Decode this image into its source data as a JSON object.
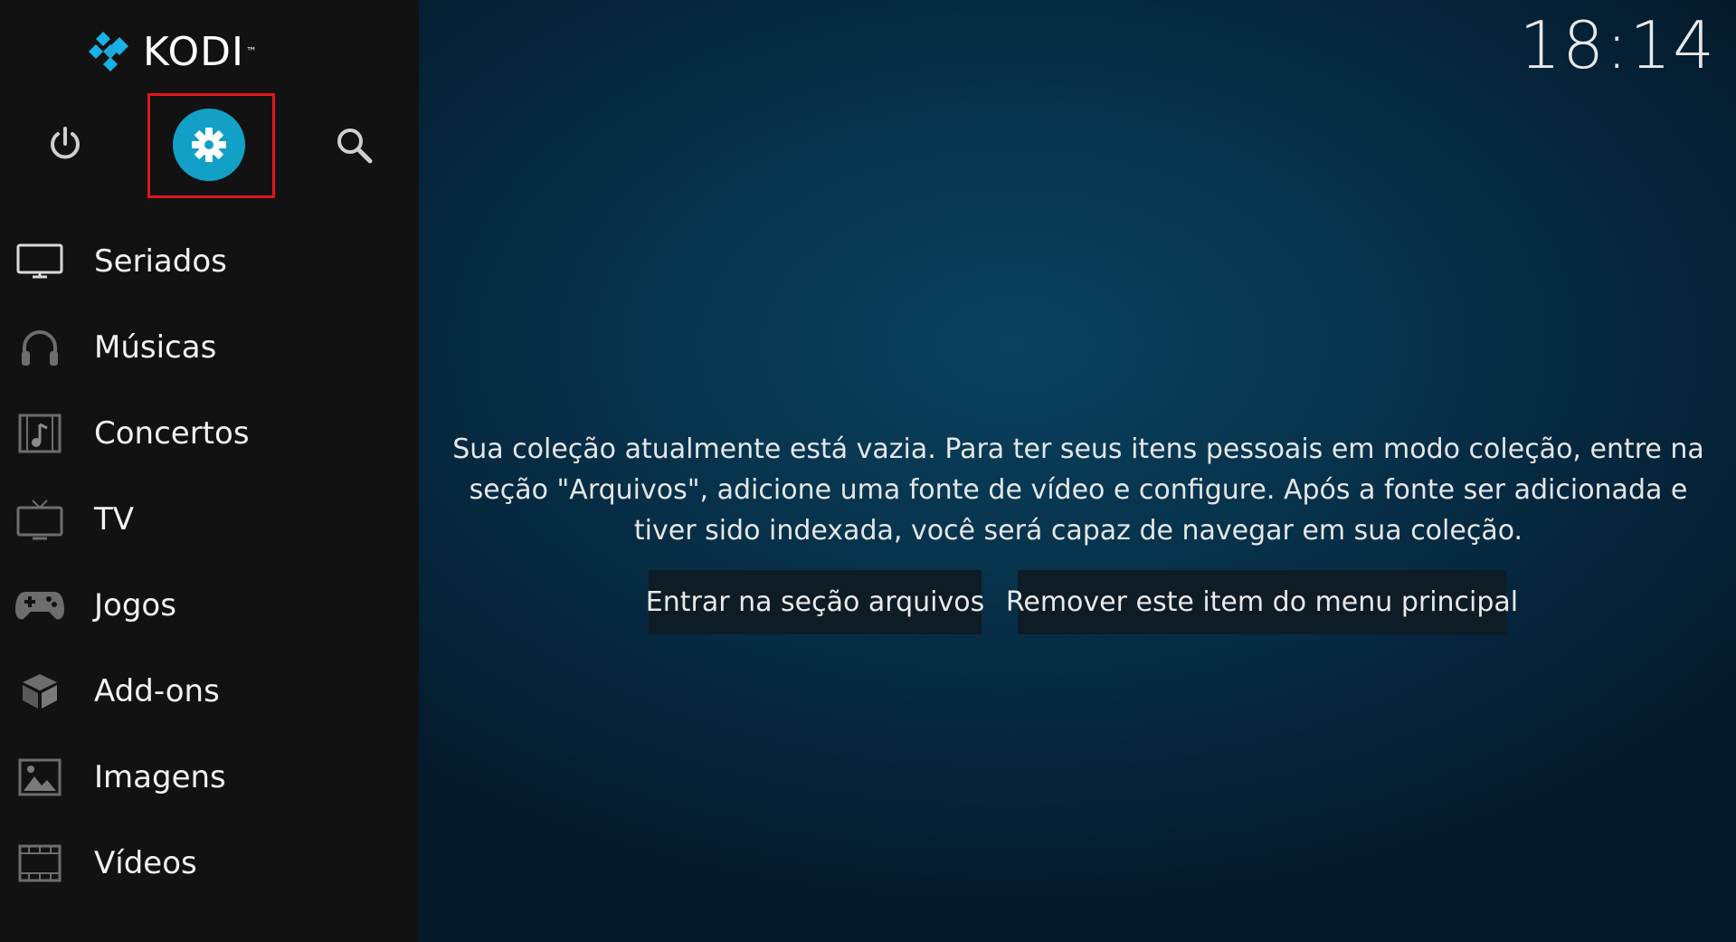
{
  "app": {
    "name": "KODI"
  },
  "header": {
    "clock": "18:14"
  },
  "colors": {
    "sidebar_bg": "#121212",
    "accent": "#12a0c7",
    "highlight_box": "#e0141e",
    "main_bg": "#07334c"
  },
  "top_controls": [
    {
      "id": "power",
      "icon": "power-icon"
    },
    {
      "id": "settings",
      "icon": "gear-icon",
      "selected": true
    },
    {
      "id": "search",
      "icon": "search-icon"
    }
  ],
  "sidebar": {
    "items": [
      {
        "label": "Seriados",
        "icon": "tv-icon"
      },
      {
        "label": "Músicas",
        "icon": "headphones-icon"
      },
      {
        "label": "Concertos",
        "icon": "music-video-icon"
      },
      {
        "label": "TV",
        "icon": "antenna-tv-icon"
      },
      {
        "label": "Jogos",
        "icon": "gamepad-icon"
      },
      {
        "label": "Add-ons",
        "icon": "box-icon"
      },
      {
        "label": "Imagens",
        "icon": "image-icon"
      },
      {
        "label": "Vídeos",
        "icon": "film-icon"
      }
    ]
  },
  "main": {
    "message": "Sua coleção atualmente está vazia. Para ter seus itens pessoais em modo coleção, entre na seção \"Arquivos\", adicione uma fonte de vídeo e configure. Após a fonte ser adicionada e tiver sido indexada, você será capaz de navegar em sua coleção.",
    "buttons": [
      {
        "label": "Entrar na seção arquivos"
      },
      {
        "label": "Remover este item do menu principal"
      }
    ]
  }
}
